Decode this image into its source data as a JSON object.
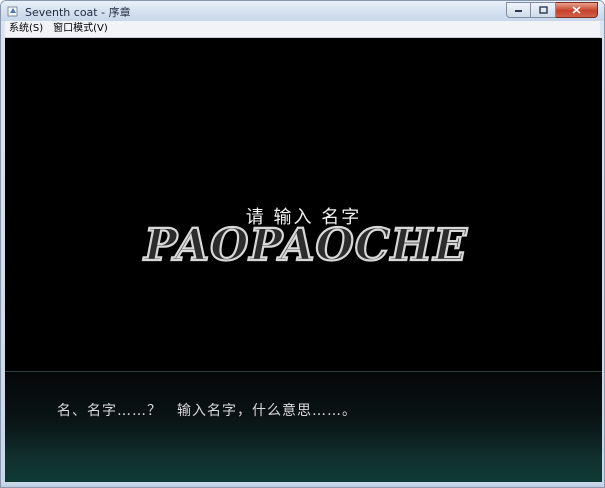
{
  "window": {
    "title": "Seventh coat - 序章"
  },
  "menu": {
    "items": [
      {
        "label": "系统(S)"
      },
      {
        "label": "窗口模式(V)"
      }
    ]
  },
  "game": {
    "prompt": "请 输入 名字",
    "dialog": "名、名字……？　输入名字，什么意思……。",
    "watermark": "PAOPAOCHE"
  },
  "icons": {
    "app": "app-icon",
    "minimize": "minimize-icon",
    "maximize": "maximize-icon",
    "close": "close-icon"
  },
  "colors": {
    "game_background": "#000000",
    "dialog_gradient_bottom": "#0e3a36",
    "close_button": "#c7412a"
  }
}
